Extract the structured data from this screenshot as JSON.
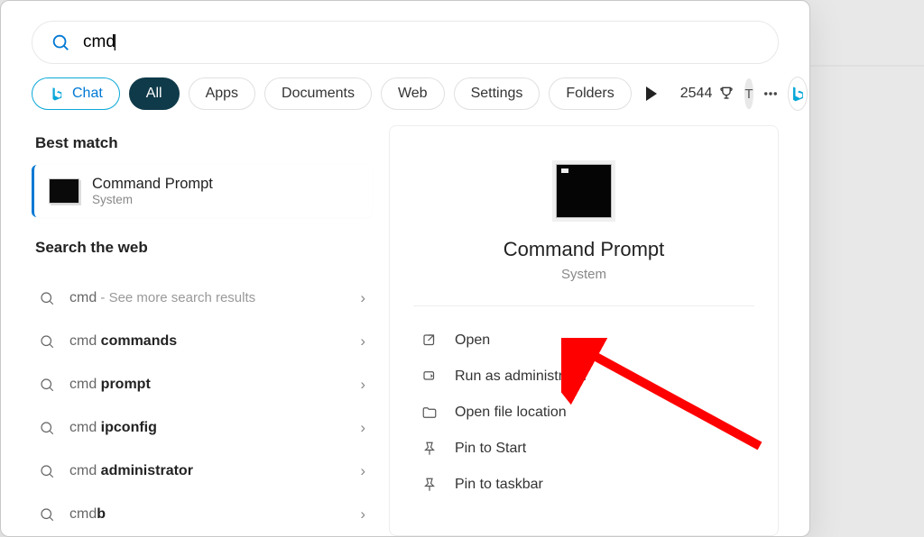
{
  "search": {
    "value": "cmd"
  },
  "filters": {
    "chat": "Chat",
    "all": "All",
    "items": [
      "Apps",
      "Documents",
      "Web",
      "Settings",
      "Folders"
    ]
  },
  "rewards": {
    "points": "2544"
  },
  "user": {
    "initial": "T"
  },
  "left": {
    "best_match_label": "Best match",
    "best": {
      "title": "Command Prompt",
      "subtitle": "System"
    },
    "search_web_label": "Search the web",
    "web": [
      {
        "prefix": "cmd",
        "bold": "",
        "hint": " - See more search results"
      },
      {
        "prefix": "cmd ",
        "bold": "commands",
        "hint": ""
      },
      {
        "prefix": "cmd ",
        "bold": "prompt",
        "hint": ""
      },
      {
        "prefix": "cmd ",
        "bold": "ipconfig",
        "hint": ""
      },
      {
        "prefix": "cmd ",
        "bold": "administrator",
        "hint": ""
      },
      {
        "prefix": "cmd",
        "bold": "b",
        "hint": ""
      }
    ]
  },
  "right": {
    "title": "Command Prompt",
    "subtitle": "System",
    "actions": {
      "open": "Open",
      "admin": "Run as administrator",
      "loc": "Open file location",
      "pin_start": "Pin to Start",
      "pin_task": "Pin to taskbar"
    }
  }
}
